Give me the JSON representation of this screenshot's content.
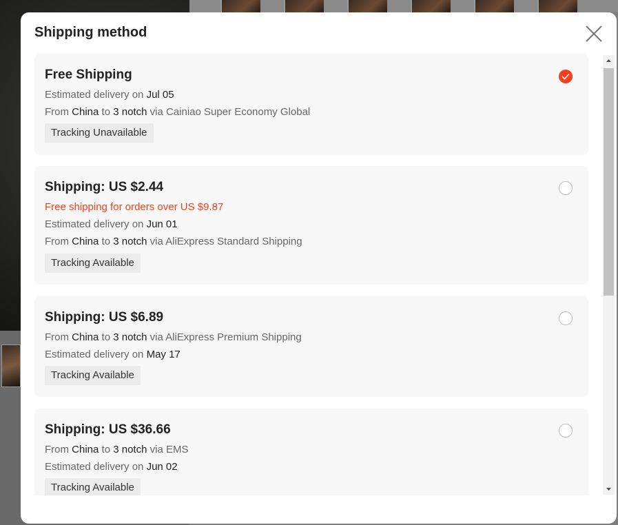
{
  "modal": {
    "title": "Shipping method"
  },
  "options": [
    {
      "title": "Free Shipping",
      "selected": true,
      "delivery_prefix": "Estimated delivery on ",
      "delivery_date": "Jul 05",
      "route_from": "From ",
      "origin": "China",
      "route_to": " to ",
      "destination": "3 notch",
      "route_via": " via Cainiao Super Economy Global",
      "tracking": "Tracking Unavailable"
    },
    {
      "title": "Shipping: US $2.44",
      "selected": false,
      "promo": "Free shipping for orders over US $9.87",
      "delivery_prefix": "Estimated delivery on ",
      "delivery_date": "Jun 01",
      "route_from": "From ",
      "origin": "China",
      "route_to": " to ",
      "destination": "3 notch",
      "route_via": " via AliExpress Standard Shipping",
      "tracking": "Tracking Available"
    },
    {
      "title": "Shipping: US $6.89",
      "selected": false,
      "route_from": "From ",
      "origin": "China",
      "route_to": " to ",
      "destination": "3 notch",
      "route_via": " via AliExpress Premium Shipping",
      "delivery_prefix": "Estimated delivery on ",
      "delivery_date": "May 17",
      "tracking": "Tracking Available"
    },
    {
      "title": "Shipping: US $36.66",
      "selected": false,
      "route_from": "From ",
      "origin": "China",
      "route_to": " to ",
      "destination": "3 notch",
      "route_via": " via EMS",
      "delivery_prefix": "Estimated delivery on ",
      "delivery_date": "Jun 02",
      "tracking": "Tracking Available"
    }
  ],
  "icons": {
    "close": "close-icon",
    "check": "check-icon",
    "scroll_up": "scroll-up-arrow-icon",
    "scroll_down": "scroll-down-arrow-icon"
  },
  "colors": {
    "accent": "#f4401c",
    "card_bg": "#f7f7f7",
    "tag_bg": "#ebebeb"
  }
}
